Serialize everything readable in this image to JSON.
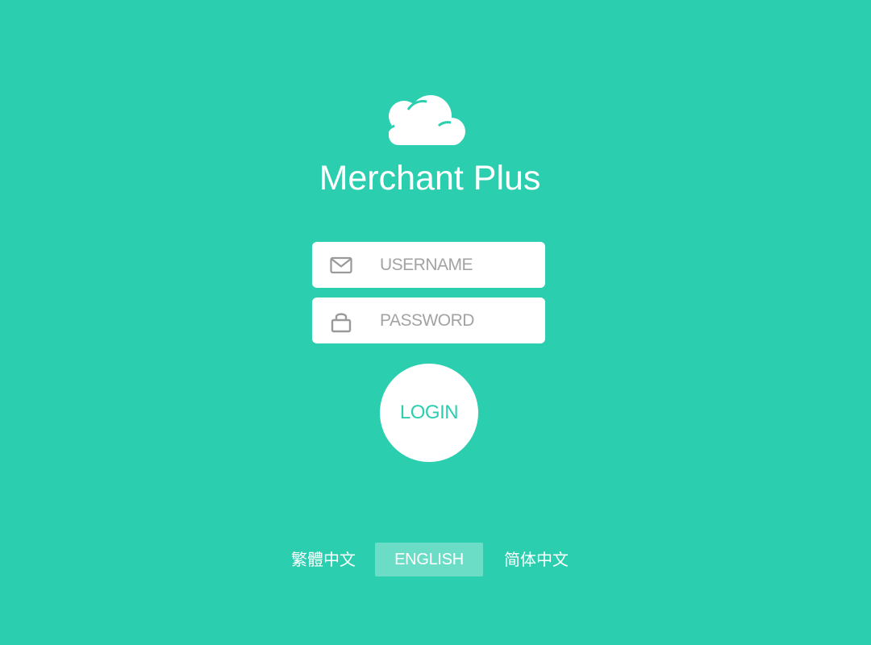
{
  "app": {
    "title": "Merchant Plus",
    "logo_icon": "cloud-icon"
  },
  "login_form": {
    "username": {
      "placeholder": "USERNAME",
      "value": "",
      "icon": "envelope-icon"
    },
    "password": {
      "placeholder": "PASSWORD",
      "value": "",
      "icon": "lock-icon"
    },
    "login_label": "LOGIN"
  },
  "languages": {
    "items": [
      {
        "label": "繁體中文",
        "active": false
      },
      {
        "label": "ENGLISH",
        "active": true
      },
      {
        "label": "简体中文",
        "active": false
      }
    ]
  },
  "colors": {
    "background": "#2bcfaf",
    "foreground": "#ffffff",
    "placeholder": "#a3a3a3",
    "icon": "#9a9a9a"
  }
}
